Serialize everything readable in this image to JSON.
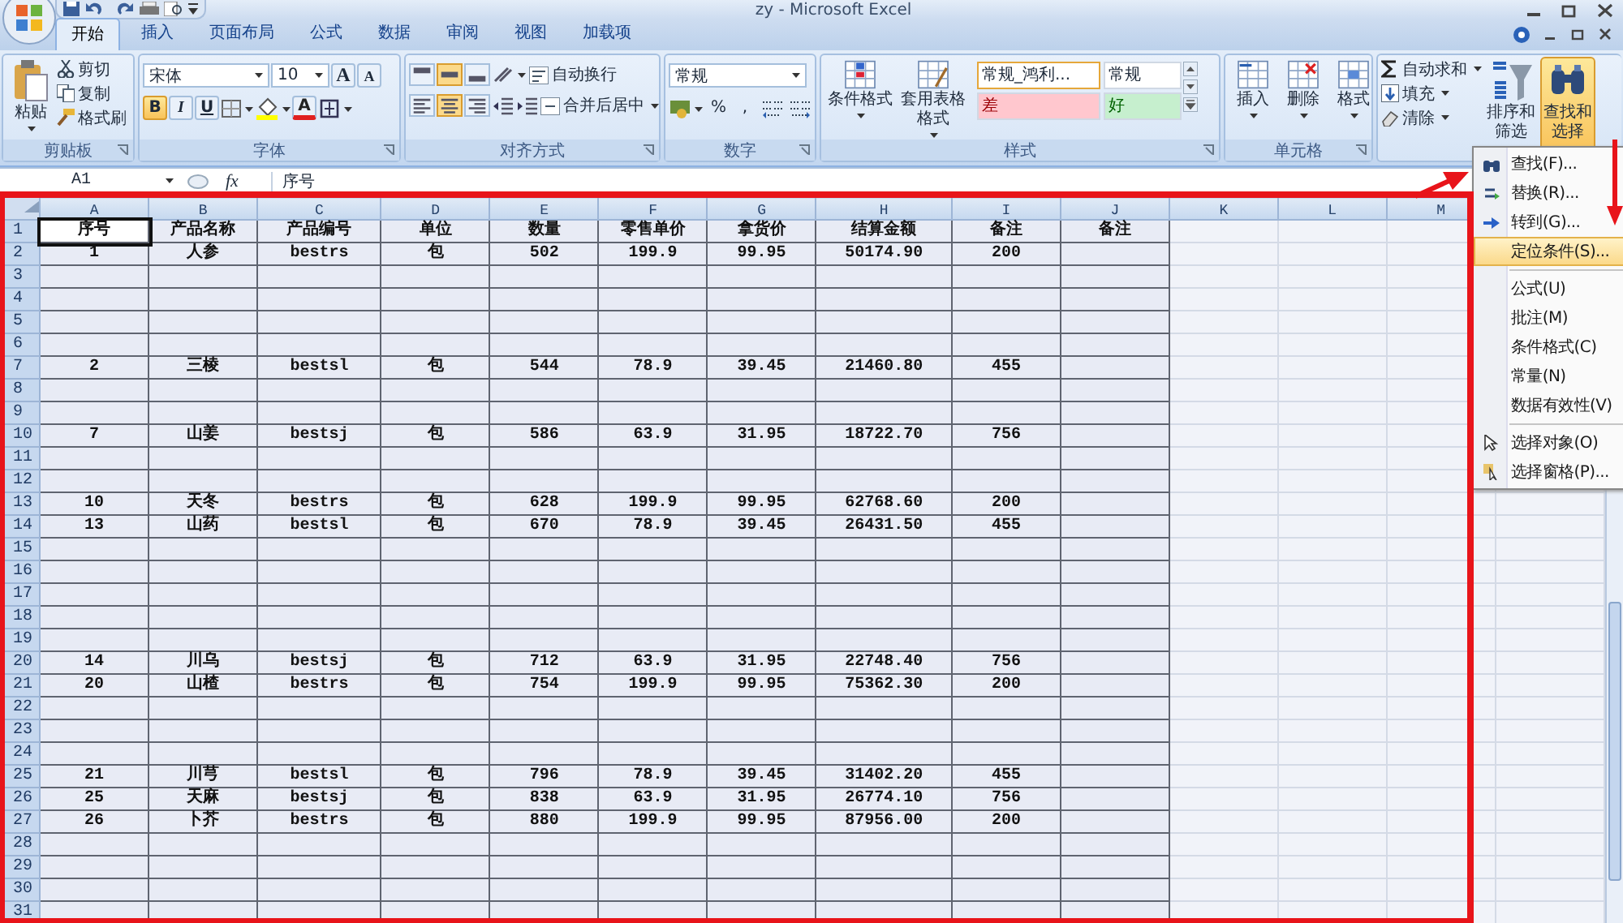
{
  "window": {
    "title": "zy - Microsoft Excel"
  },
  "tabs": [
    {
      "label": "开始",
      "selected": true
    },
    {
      "label": "插入",
      "selected": false
    },
    {
      "label": "页面布局",
      "selected": false
    },
    {
      "label": "公式",
      "selected": false
    },
    {
      "label": "数据",
      "selected": false
    },
    {
      "label": "审阅",
      "selected": false
    },
    {
      "label": "视图",
      "selected": false
    },
    {
      "label": "加载项",
      "selected": false
    }
  ],
  "ribbon": {
    "groups": [
      {
        "kind": "clipboard",
        "label": "剪贴板",
        "paste": "粘贴",
        "items": [
          "剪切",
          "复制",
          "格式刷"
        ]
      },
      {
        "kind": "font",
        "label": "字体",
        "font": "宋体",
        "size": "10",
        "grow": "A",
        "shrink": "A",
        "font_color_letter": "A",
        "styles": [
          {
            "label": "B",
            "selected": true
          },
          {
            "label": "I",
            "selected": false
          },
          {
            "label": "U",
            "selected": false
          }
        ]
      },
      {
        "kind": "align",
        "label": "对齐方式",
        "wrap": "自动换行",
        "merge": "合并后居中",
        "vertical": [
          {
            "selected": false
          },
          {
            "selected": true
          },
          {
            "selected": false
          }
        ],
        "horizontal": [
          {
            "selected": false
          },
          {
            "selected": true
          },
          {
            "selected": false
          }
        ]
      },
      {
        "kind": "number",
        "label": "数字",
        "format": "常规",
        "percent": "%",
        "comma": ","
      },
      {
        "kind": "styles",
        "label": "样式",
        "buttons": [
          "条件格式",
          "套用表格格式"
        ],
        "gallery": [
          {
            "label": "常规_鸿利...",
            "color": "#ffffff",
            "selected": true
          },
          {
            "label": "常规",
            "color": "#ffffff",
            "selected": false
          },
          {
            "label": "差",
            "color": "#ffc7ce",
            "selected": false
          },
          {
            "label": "好",
            "color": "#c6efce",
            "selected": false
          }
        ]
      },
      {
        "kind": "cells",
        "label": "单元格",
        "buttons": [
          "插入",
          "删除",
          "格式"
        ]
      },
      {
        "kind": "editing",
        "items": [
          "自动求和",
          "填充",
          "清除"
        ],
        "buttons": [
          {
            "label": "排序和筛选",
            "selected": false
          },
          {
            "label": "查找和选择",
            "selected": true
          }
        ]
      }
    ]
  },
  "formula_bar": {
    "name_box": "A1",
    "fx": "fx",
    "formula": "序号"
  },
  "sheet": {
    "columns": [
      "A",
      "B",
      "C",
      "D",
      "E",
      "F",
      "G",
      "H",
      "I",
      "J",
      "K",
      "L",
      "M"
    ],
    "rows": [
      {
        "header": "1",
        "cells": [
          {
            "text": "序号",
            "selected": true
          },
          {
            "text": "产品名称",
            "selected": false
          },
          {
            "text": "产品编号",
            "selected": false
          },
          {
            "text": "单位",
            "selected": false
          },
          {
            "text": "数量",
            "selected": false
          },
          {
            "text": "零售单价",
            "selected": false
          },
          {
            "text": "拿货价",
            "selected": false
          },
          {
            "text": "结算金额",
            "selected": false
          },
          {
            "text": "备注",
            "selected": false
          },
          {
            "text": "备注",
            "selected": false
          }
        ]
      },
      {
        "header": "2",
        "cells": [
          {
            "text": "1",
            "selected": false
          },
          {
            "text": "人参",
            "selected": false
          },
          {
            "text": "bestrs",
            "selected": false
          },
          {
            "text": "包",
            "selected": false
          },
          {
            "text": "502",
            "selected": false
          },
          {
            "text": "199.9",
            "selected": false
          },
          {
            "text": "99.95",
            "selected": false
          },
          {
            "text": "50174.90",
            "selected": false
          },
          {
            "text": "200",
            "selected": false
          }
        ]
      },
      {
        "header": "3"
      },
      {
        "header": "4"
      },
      {
        "header": "5"
      },
      {
        "header": "6"
      },
      {
        "header": "7",
        "cells": [
          {
            "text": "2",
            "selected": false
          },
          {
            "text": "三棱",
            "selected": false
          },
          {
            "text": "bestsl",
            "selected": false
          },
          {
            "text": "包",
            "selected": false
          },
          {
            "text": "544",
            "selected": false
          },
          {
            "text": "78.9",
            "selected": false
          },
          {
            "text": "39.45",
            "selected": false
          },
          {
            "text": "21460.80",
            "selected": false
          },
          {
            "text": "455",
            "selected": false
          }
        ]
      },
      {
        "header": "8"
      },
      {
        "header": "9"
      },
      {
        "header": "10",
        "cells": [
          {
            "text": "7",
            "selected": false
          },
          {
            "text": "山姜",
            "selected": false
          },
          {
            "text": "bestsj",
            "selected": false
          },
          {
            "text": "包",
            "selected": false
          },
          {
            "text": "586",
            "selected": false
          },
          {
            "text": "63.9",
            "selected": false
          },
          {
            "text": "31.95",
            "selected": false
          },
          {
            "text": "18722.70",
            "selected": false
          },
          {
            "text": "756",
            "selected": false
          }
        ]
      },
      {
        "header": "11"
      },
      {
        "header": "12"
      },
      {
        "header": "13",
        "cells": [
          {
            "text": "10",
            "selected": false
          },
          {
            "text": "天冬",
            "selected": false
          },
          {
            "text": "bestrs",
            "selected": false
          },
          {
            "text": "包",
            "selected": false
          },
          {
            "text": "628",
            "selected": false
          },
          {
            "text": "199.9",
            "selected": false
          },
          {
            "text": "99.95",
            "selected": false
          },
          {
            "text": "62768.60",
            "selected": false
          },
          {
            "text": "200",
            "selected": false
          }
        ]
      },
      {
        "header": "14",
        "cells": [
          {
            "text": "13",
            "selected": false
          },
          {
            "text": "山药",
            "selected": false
          },
          {
            "text": "bestsl",
            "selected": false
          },
          {
            "text": "包",
            "selected": false
          },
          {
            "text": "670",
            "selected": false
          },
          {
            "text": "78.9",
            "selected": false
          },
          {
            "text": "39.45",
            "selected": false
          },
          {
            "text": "26431.50",
            "selected": false
          },
          {
            "text": "455",
            "selected": false
          }
        ]
      },
      {
        "header": "15"
      },
      {
        "header": "16"
      },
      {
        "header": "17"
      },
      {
        "header": "18"
      },
      {
        "header": "19"
      },
      {
        "header": "20",
        "cells": [
          {
            "text": "14",
            "selected": false
          },
          {
            "text": "川乌",
            "selected": false
          },
          {
            "text": "bestsj",
            "selected": false
          },
          {
            "text": "包",
            "selected": false
          },
          {
            "text": "712",
            "selected": false
          },
          {
            "text": "63.9",
            "selected": false
          },
          {
            "text": "31.95",
            "selected": false
          },
          {
            "text": "22748.40",
            "selected": false
          },
          {
            "text": "756",
            "selected": false
          }
        ]
      },
      {
        "header": "21",
        "cells": [
          {
            "text": "20",
            "selected": false
          },
          {
            "text": "山楂",
            "selected": false
          },
          {
            "text": "bestrs",
            "selected": false
          },
          {
            "text": "包",
            "selected": false
          },
          {
            "text": "754",
            "selected": false
          },
          {
            "text": "199.9",
            "selected": false
          },
          {
            "text": "99.95",
            "selected": false
          },
          {
            "text": "75362.30",
            "selected": false
          },
          {
            "text": "200",
            "selected": false
          }
        ]
      },
      {
        "header": "22"
      },
      {
        "header": "23"
      },
      {
        "header": "24"
      },
      {
        "header": "25",
        "cells": [
          {
            "text": "21",
            "selected": false
          },
          {
            "text": "川芎",
            "selected": false
          },
          {
            "text": "bestsl",
            "selected": false
          },
          {
            "text": "包",
            "selected": false
          },
          {
            "text": "796",
            "selected": false
          },
          {
            "text": "78.9",
            "selected": false
          },
          {
            "text": "39.45",
            "selected": false
          },
          {
            "text": "31402.20",
            "selected": false
          },
          {
            "text": "455",
            "selected": false
          }
        ]
      },
      {
        "header": "26",
        "cells": [
          {
            "text": "25",
            "selected": false
          },
          {
            "text": "天麻",
            "selected": false
          },
          {
            "text": "bestsj",
            "selected": false
          },
          {
            "text": "包",
            "selected": false
          },
          {
            "text": "838",
            "selected": false
          },
          {
            "text": "63.9",
            "selected": false
          },
          {
            "text": "31.95",
            "selected": false
          },
          {
            "text": "26774.10",
            "selected": false
          },
          {
            "text": "756",
            "selected": false
          }
        ]
      },
      {
        "header": "27",
        "cells": [
          {
            "text": "26",
            "selected": false
          },
          {
            "text": "卜芥",
            "selected": false
          },
          {
            "text": "bestrs",
            "selected": false
          },
          {
            "text": "包",
            "selected": false
          },
          {
            "text": "880",
            "selected": false
          },
          {
            "text": "199.9",
            "selected": false
          },
          {
            "text": "99.95",
            "selected": false
          },
          {
            "text": "87956.00",
            "selected": false
          },
          {
            "text": "200",
            "selected": false
          }
        ]
      },
      {
        "header": "28"
      },
      {
        "header": "29"
      },
      {
        "header": "30"
      },
      {
        "header": "31"
      }
    ]
  },
  "menu": {
    "items": [
      {
        "label": "查找(F)...",
        "kind": "find",
        "selected": false
      },
      {
        "label": "替换(R)...",
        "kind": "replace",
        "selected": false
      },
      {
        "label": "转到(G)...",
        "kind": "goto",
        "selected": false
      },
      {
        "label": "定位条件(S)...",
        "kind": "plain",
        "selected": true
      },
      {
        "kind": "separator"
      },
      {
        "label": "公式(U)",
        "kind": "plain",
        "selected": false
      },
      {
        "label": "批注(M)",
        "kind": "plain",
        "selected": false
      },
      {
        "label": "条件格式(C)",
        "kind": "plain",
        "selected": false
      },
      {
        "label": "常量(N)",
        "kind": "plain",
        "selected": false
      },
      {
        "label": "数据有效性(V)",
        "kind": "plain",
        "selected": false
      },
      {
        "kind": "separator"
      },
      {
        "label": "选择对象(O)",
        "kind": "pointer",
        "selected": false
      },
      {
        "label": "选择窗格(P)...",
        "kind": "pane",
        "selected": false
      }
    ]
  }
}
